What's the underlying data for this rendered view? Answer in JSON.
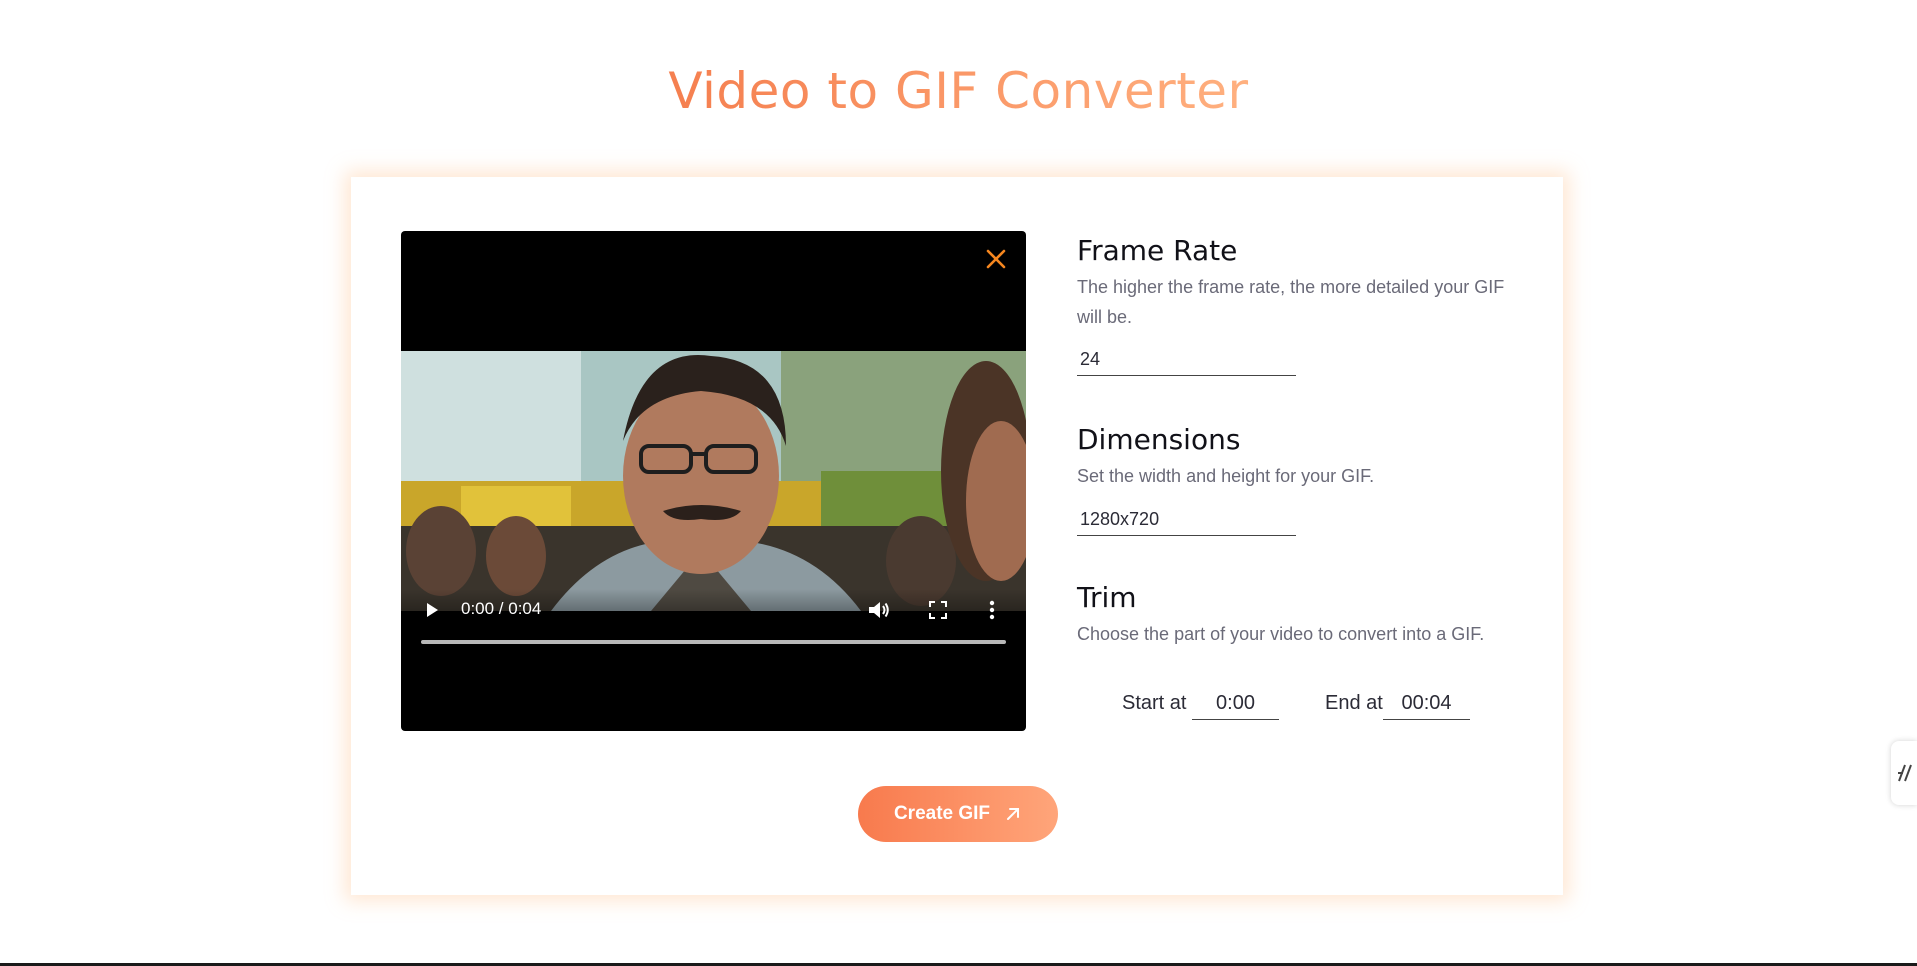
{
  "page": {
    "title": "Video to GIF Converter"
  },
  "video": {
    "time_display": "0:00 / 0:04",
    "progress": 0
  },
  "settings": {
    "frame_rate": {
      "title": "Frame Rate",
      "description": "The higher the frame rate, the more detailed your GIF will be.",
      "value": "24"
    },
    "dimensions": {
      "title": "Dimensions",
      "description": "Set the width and height for your GIF.",
      "value": "1280x720"
    },
    "trim": {
      "title": "Trim",
      "description": "Choose the part of your video to convert into a GIF.",
      "start_label": "Start at",
      "start_value": "0:00",
      "end_label": "End at",
      "end_value": "00:04"
    }
  },
  "actions": {
    "create_label": "Create GIF"
  },
  "colors": {
    "accent": "#f58a57",
    "accent_light": "#ffa57a",
    "close_icon": "#f5861f"
  },
  "icons": {
    "close": "close-icon",
    "play": "play-icon",
    "volume": "volume-icon",
    "fullscreen": "fullscreen-icon",
    "more": "more-vertical-icon",
    "arrow": "arrow-up-right-icon",
    "side_widget": "side-widget-icon"
  }
}
